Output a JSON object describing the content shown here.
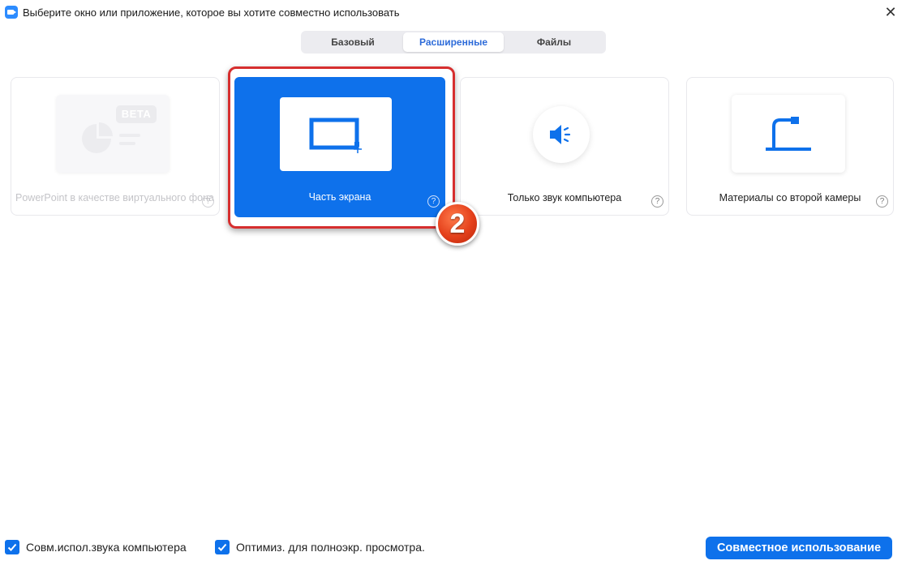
{
  "window": {
    "title": "Выберите окно или приложение, которое вы хотите совместно использовать",
    "close_glyph": "✕"
  },
  "tabs": [
    {
      "label": "Базовый",
      "active": false
    },
    {
      "label": "Расширенные",
      "active": true
    },
    {
      "label": "Файлы",
      "active": false
    }
  ],
  "cards": {
    "powerpoint": {
      "label": "PowerPoint в качестве виртуального фона",
      "badge": "BETA",
      "help": "?",
      "icon": "pie-chart-icon",
      "disabled": true
    },
    "portion": {
      "label": "Часть экрана",
      "help": "?",
      "icon": "screen-portion-icon",
      "selected": true
    },
    "audio": {
      "label": "Только звук компьютера",
      "help": "?",
      "icon": "speaker-icon"
    },
    "camera": {
      "label": "Материалы со второй камеры",
      "help": "?",
      "icon": "document-camera-icon"
    }
  },
  "annotation": {
    "step": "2",
    "color": "#e4401b"
  },
  "footer": {
    "share_sound": {
      "label": "Совм.испол.звука компьютера",
      "checked": true
    },
    "optimize": {
      "label": "Оптимиз. для полноэкр. просмотра.",
      "checked": true
    },
    "share_button": "Совместное использование"
  },
  "colors": {
    "accent": "#0e71eb",
    "highlight_border": "#d62e2e"
  }
}
